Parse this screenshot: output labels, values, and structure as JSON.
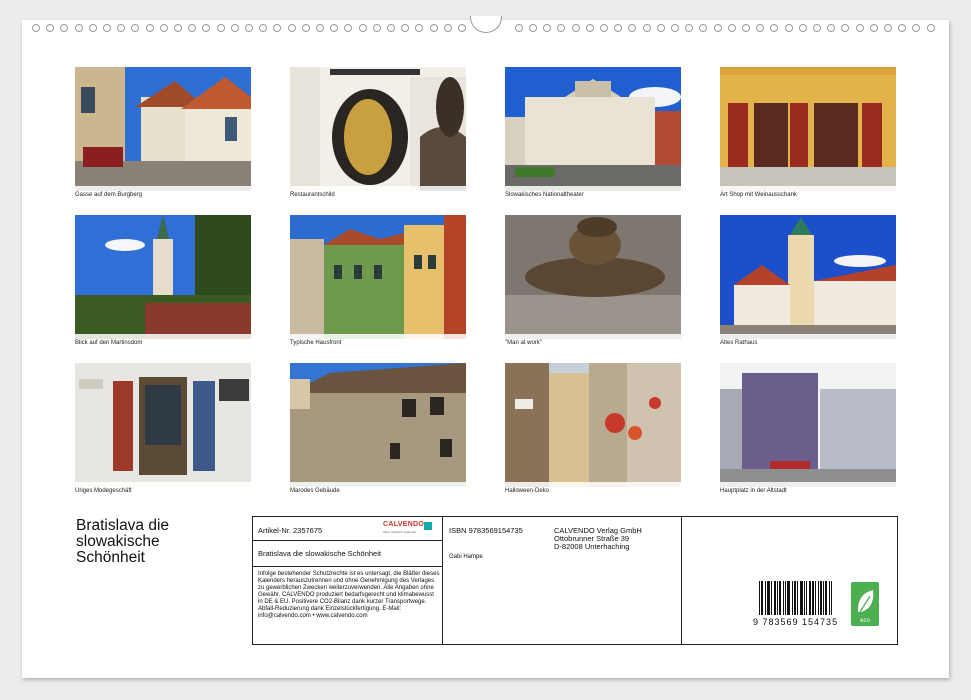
{
  "photos": [
    {
      "caption": "Gasse auf dem Burgberg"
    },
    {
      "caption": "Restaurantschild"
    },
    {
      "caption": "Slowakisches Nationaltheater"
    },
    {
      "caption": "Art Shop mit Weinausschank"
    },
    {
      "caption": "Blick auf den Martinsdom"
    },
    {
      "caption": "Typische Hausfront"
    },
    {
      "caption": "\"Man at work\""
    },
    {
      "caption": "Altes Rathaus"
    },
    {
      "caption": "Uriges Modegeschäft"
    },
    {
      "caption": "Marodes Gebäude"
    },
    {
      "caption": "Halloween-Deko"
    },
    {
      "caption": "Hauptplatz in der Altstadt"
    }
  ],
  "calendar_title": "Bratislava die slowakische Schönheit",
  "info": {
    "article_number": "Artikel-Nr. 2357675",
    "logo_text": "CALVENDO",
    "logo_sub": "Alles. Sachlich. Kalender.",
    "title_line": "Bratislava die slowakische Schönheit",
    "legal_text": "Infolge bestehender Schutzrechte ist es untersagt, die Blätter dieses Kalenders herauszutrennen und ohne Genehmigung des Verlages zu gewerblichen Zwecken weiterzuverwenden. Alle Angaben ohne Gewähr. CALVENDO produziert bedarfsgerecht und klimabewusst in DE & EU. Positivere CO2-Bilanz dank kurzer Transportwege. Abfall-Reduzierung dank Einzelstückfertigung. E-Mail: info@calvendo.com • www.calvendo.com",
    "isbn": "ISBN 9783569154735",
    "publisher_name": "CALVENDO Verlag GmbH",
    "publisher_street": "Ottobrunner Straße 39",
    "publisher_city": "D-82008 Unterhaching",
    "author": "Gabi Hampe",
    "barcode_number": "9 783569 154735",
    "eco_label": "eco"
  },
  "colors": {
    "sky_blue": "#2c6fd6",
    "brick_red": "#b8452c",
    "eco_green": "#4caf50",
    "calvendo_red": "#d5302a"
  }
}
